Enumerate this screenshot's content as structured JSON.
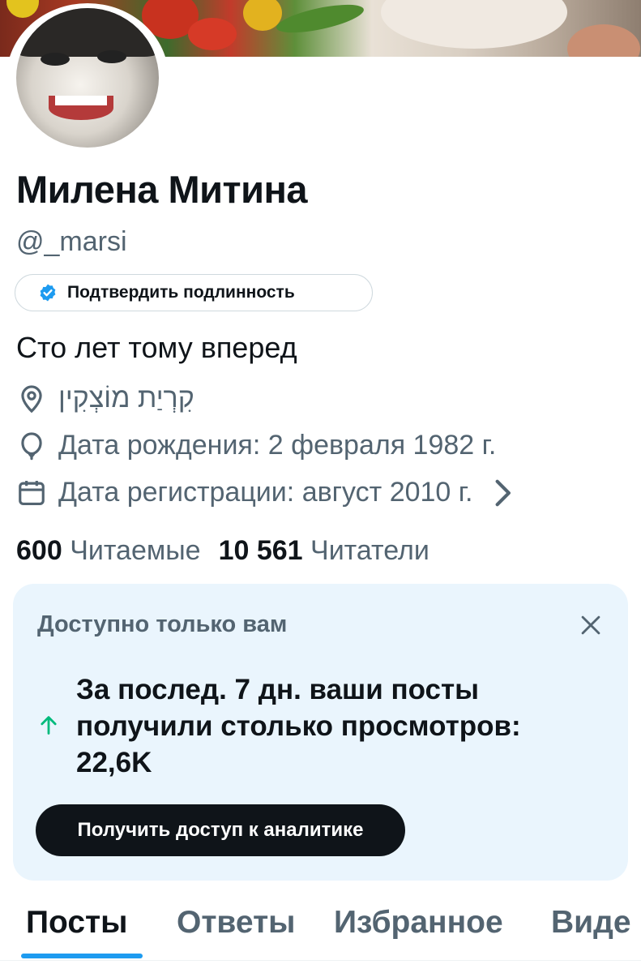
{
  "profile": {
    "name": "Милена Митина",
    "handle": "@_marsi",
    "verify_label": "Подтвердить подлинность",
    "bio": "Сто лет тому вперед",
    "location": "קִרְיַת מוֹצְקִין",
    "birthdate": "Дата рождения: 2 февраля 1982 г.",
    "joined": "Дата регистрации: август 2010 г."
  },
  "stats": {
    "following_count": "600",
    "following_label": "Читаемые",
    "followers_count": "10 561",
    "followers_label": "Читатели"
  },
  "analytics_card": {
    "title": "Доступно только вам",
    "message": "За послед. 7 дн. ваши посты получили столько просмотров: 22,6K",
    "button_label": "Получить доступ к аналитике"
  },
  "tabs": [
    {
      "label": "Посты",
      "active": true
    },
    {
      "label": "Ответы",
      "active": false
    },
    {
      "label": "Избранное",
      "active": false
    },
    {
      "label": "Виде",
      "active": false
    }
  ],
  "icons": {
    "verified": "verified-badge-icon",
    "location": "location-pin-icon",
    "birthday": "balloon-icon",
    "calendar": "calendar-icon",
    "chevron": "chevron-right-icon",
    "close": "close-icon",
    "trend": "arrow-up-icon"
  },
  "colors": {
    "accent": "#1d9bf0",
    "text_primary": "#0f1419",
    "text_secondary": "#536471",
    "card_bg": "#eaf5fd",
    "trend_green": "#00ba7c"
  }
}
